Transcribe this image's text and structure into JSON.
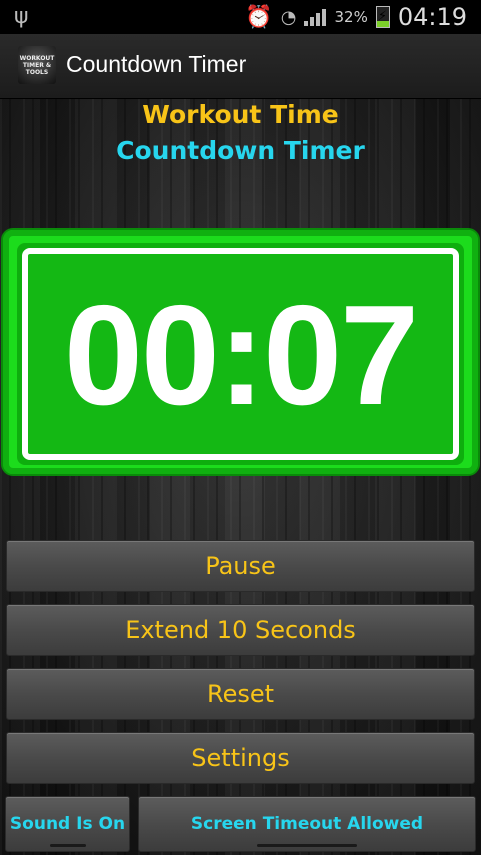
{
  "status_bar": {
    "usb_icon": "usb-icon",
    "alarm_icon": "alarm-icon",
    "wifi_icon": "wifi-icon",
    "signal_icon": "signal-icon",
    "battery_percent": "32%",
    "battery_level": 0.32,
    "battery_color": "#7ccf2a",
    "clock": "04:19"
  },
  "action_bar": {
    "app_icon_text": "WORKOUT TIMER & TOOLS",
    "title": "Countdown Timer"
  },
  "header": {
    "line1": "Workout Time",
    "line2": "Countdown Timer",
    "line1_color": "#f8c418",
    "line2_color": "#27d6ee"
  },
  "timer": {
    "display": "00:07",
    "color": "#14b814"
  },
  "buttons": {
    "pause": "Pause",
    "extend": "Extend 10 Seconds",
    "reset": "Reset",
    "settings": "Settings",
    "sound": "Sound Is On",
    "screen_timeout": "Screen Timeout Allowed"
  }
}
